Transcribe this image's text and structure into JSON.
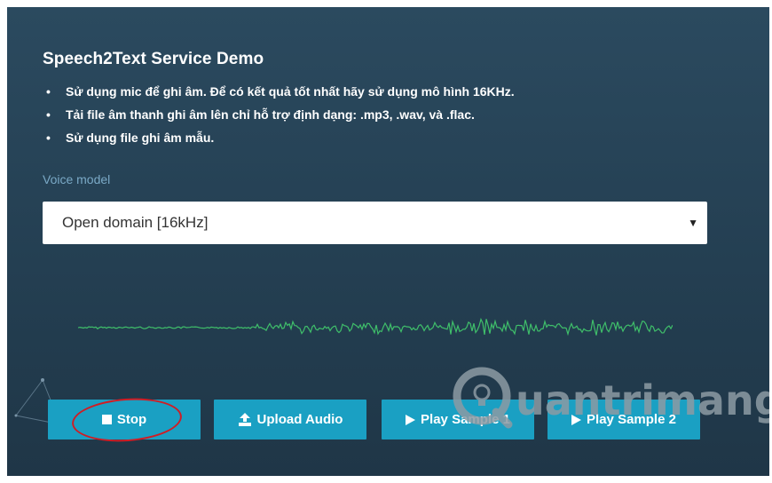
{
  "header": {
    "title": "Speech2Text Service Demo"
  },
  "instructions": [
    "Sử dụng mic để ghi âm. Để có kết quả tốt nhất hãy sử dụng mô hình 16KHz.",
    "Tải file âm thanh ghi âm lên chỉ hỗ trợ định dạng: .mp3, .wav, và .flac.",
    "Sử dụng file ghi âm mẫu."
  ],
  "bullet_char": "•",
  "voice_model": {
    "label": "Voice model",
    "selected": "Open domain [16kHz]",
    "arrow": "▼"
  },
  "buttons": {
    "stop": {
      "label": "Stop",
      "icon": "stop-square-icon"
    },
    "upload": {
      "label": "Upload Audio",
      "icon": "upload-icon"
    },
    "sample1": {
      "label": "Play Sample 1",
      "icon": "play-icon"
    },
    "sample2": {
      "label": "Play Sample 2",
      "icon": "play-icon"
    }
  },
  "watermark": {
    "text": "uantrimang"
  },
  "colors": {
    "background": "#274559",
    "button": "#1aa0c3",
    "waveform": "#3fbf6a",
    "annotation": "#d01c24",
    "label": "#7aa9c6"
  }
}
